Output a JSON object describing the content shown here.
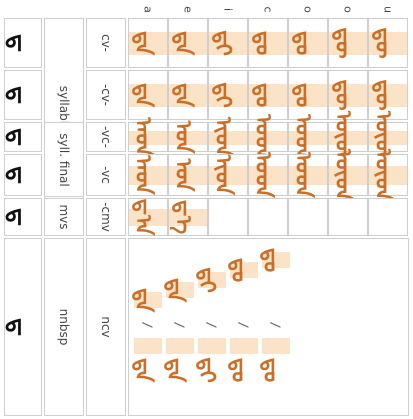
{
  "vowels": [
    "a",
    "e",
    "i",
    "c",
    "o",
    "o",
    "u"
  ],
  "rows": [
    {
      "section": "syllable initial",
      "form": "cv-",
      "glyph": "ᠳ"
    },
    {
      "section": "",
      "form": "-cv-",
      "glyph": "ᠳ"
    },
    {
      "section": "syll. final",
      "form": "-vc-",
      "glyph": "ᠳ"
    },
    {
      "section": "",
      "form": "-vc",
      "glyph": "ᠳ"
    },
    {
      "section": "mvs",
      "form": "-cmv",
      "glyph": "ᠳ"
    },
    {
      "section": "nnbsp",
      "form": "ncv",
      "glyph": "ᠳ"
    }
  ],
  "cell_glyphs": {
    "cv": [
      "ᠳᠠ",
      "ᠳᠡ",
      "ᠳᠢ",
      "ᠳᠣ",
      "ᠳᠤ",
      "ᠳᠥ",
      "ᠳᠦ"
    ],
    "mid": [
      "ᠳᠠ",
      "ᠳᠡ",
      "ᠳᠢ",
      "ᠳᠣ",
      "ᠳᠤ",
      "ᠳᠥ",
      "ᠳᠦ"
    ],
    "vc_mid": [
      "ᠠᠳ",
      "ᠡᠳ",
      "ᠢᠳ",
      "ᠣᠳ",
      "ᠤᠳ",
      "ᠥᠳ",
      "ᠦᠳ"
    ],
    "vc_end": [
      "ᠠᠳ",
      "ᠡᠳ",
      "ᠢᠳ",
      "ᠣᠳ",
      "ᠤᠳ",
      "ᠥᠳ",
      "ᠦᠳ"
    ],
    "mvs": [
      "ᠳ᠎ᠠ",
      "ᠳ᠎ᠡ"
    ],
    "ncv": [
      "ᠳᠠ",
      "ᠳᠡ",
      "ᠳᠢ",
      "ᠳᠣ",
      "ᠳᠤ"
    ]
  },
  "ncv_separator": "/"
}
